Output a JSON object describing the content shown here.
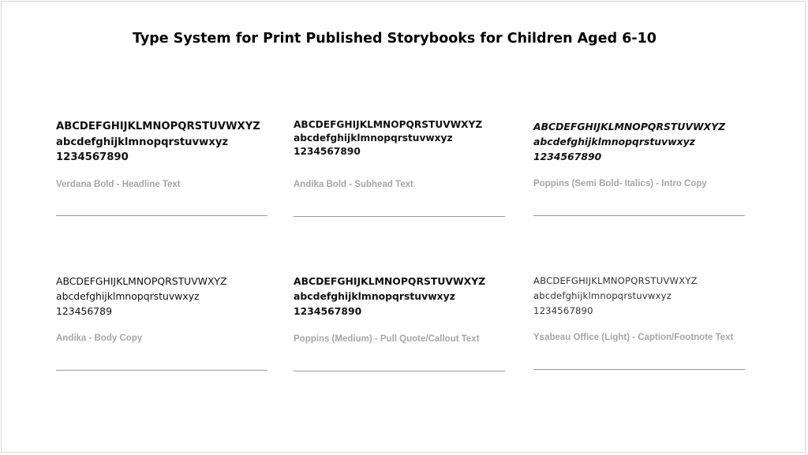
{
  "title": "Type System for Print Published Storybooks for Children Aged 6-10",
  "specimens": [
    {
      "uppercase": "ABCDEFGHIJKLMNOPQRSTUVWXYZ",
      "lowercase": "abcdefghijklmnopqrstuvwxyz",
      "numerals": "1234567890",
      "caption": "Verdana Bold - Headline Text"
    },
    {
      "uppercase": "ABCDEFGHIJKLMNOPQRSTUVWXYZ",
      "lowercase": "abcdefghijklmnopqrstuvwxyz",
      "numerals": "1234567890",
      "caption": "Andika Bold - Subhead Text"
    },
    {
      "uppercase": "ABCDEFGHIJKLMNOPQRSTUVWXYZ",
      "lowercase": "abcdefghijklmnopqrstuvwxyz",
      "numerals": "1234567890",
      "caption": "Poppins (Semi Bold- Italics) - Intro Copy"
    },
    {
      "uppercase": "ABCDEFGHIJKLMNOPQRSTUVWXYZ",
      "lowercase": "abcdefghijklmnopqrstuvwxyz",
      "numerals": "123456789",
      "caption": "Andika - Body Copy"
    },
    {
      "uppercase": "ABCDEFGHIJKLMNOPQRSTUVWXYZ",
      "lowercase": "abcdefghijklmnopqrstuvwxyz",
      "numerals": "1234567890",
      "caption": "Poppins (Medium) - Pull Quote/Callout Text"
    },
    {
      "uppercase": "ABCDEFGHIJKLMNOPQRSTUVWXYZ",
      "lowercase": "abcdefghijklmnopqrstuvwxyz",
      "numerals": "1234567890",
      "caption": "Ysabeau Office (Light) - Caption/Footnote Text"
    }
  ]
}
